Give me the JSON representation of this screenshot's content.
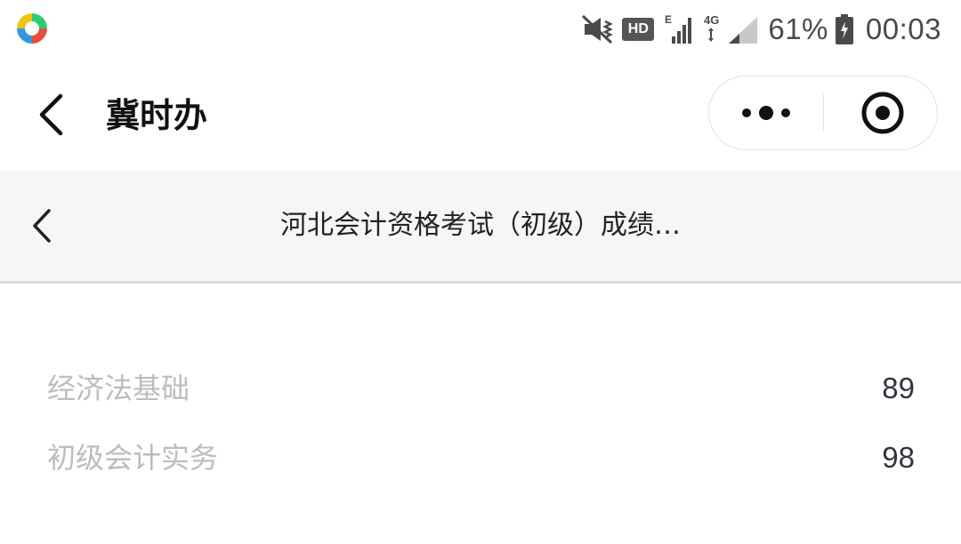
{
  "status_bar": {
    "icons": [
      "app-logo-icon",
      "mute-vibrate-icon",
      "hd-badge",
      "signal-e-icon",
      "signal-4g-icon",
      "battery-icon"
    ],
    "hd_label": "HD",
    "battery_percent": "61%",
    "time": "00:03"
  },
  "title_bar": {
    "back_icon": "chevron-left-icon",
    "title": "冀时办",
    "capsule": {
      "more_icon": "more-dots-icon",
      "close_icon": "target-close-icon"
    }
  },
  "web_nav": {
    "back_icon": "chevron-left-icon",
    "title": "河北会计资格考试（初级）成绩…"
  },
  "scores": [
    {
      "subject": "经济法基础",
      "score": "89"
    },
    {
      "subject": "初级会计实务",
      "score": "98"
    }
  ],
  "colors": {
    "label_gray": "#bcbcc2",
    "value_dark": "#333340",
    "nav_bg": "#f6f6f6"
  }
}
